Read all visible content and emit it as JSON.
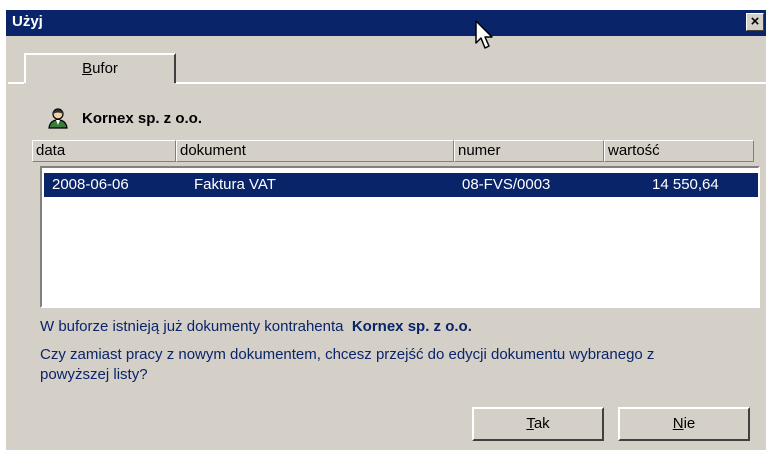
{
  "window": {
    "title": "Użyj",
    "close_glyph": "×"
  },
  "tab": {
    "first_letter": "B",
    "rest": "ufor"
  },
  "contractor": {
    "name": "Kornex sp. z o.o.",
    "icon": "person-icon"
  },
  "columns": [
    "data",
    "dokument",
    "numer",
    "wartość"
  ],
  "rows": [
    {
      "date": "2008-06-06",
      "document": "Faktura VAT",
      "number": "08-FVS/0003",
      "value": "14 550,64"
    }
  ],
  "message": {
    "line1_prefix": "W buforze istnieją już dokumenty kontrahenta",
    "line1_name": "Kornex sp. z o.o.",
    "line2": "Czy zamiast pracy z nowym dokumentem, chcesz przejść do edycji dokumentu wybranego z",
    "line3": "powyższej listy?"
  },
  "buttons": {
    "yes_first": "T",
    "yes_rest": "ak",
    "no_first": "N",
    "no_rest": "ie"
  },
  "colors": {
    "titlebar": "#0a246a",
    "face": "#d4d0c8",
    "selection": "#0a246a",
    "message_text": "#0a246a"
  }
}
